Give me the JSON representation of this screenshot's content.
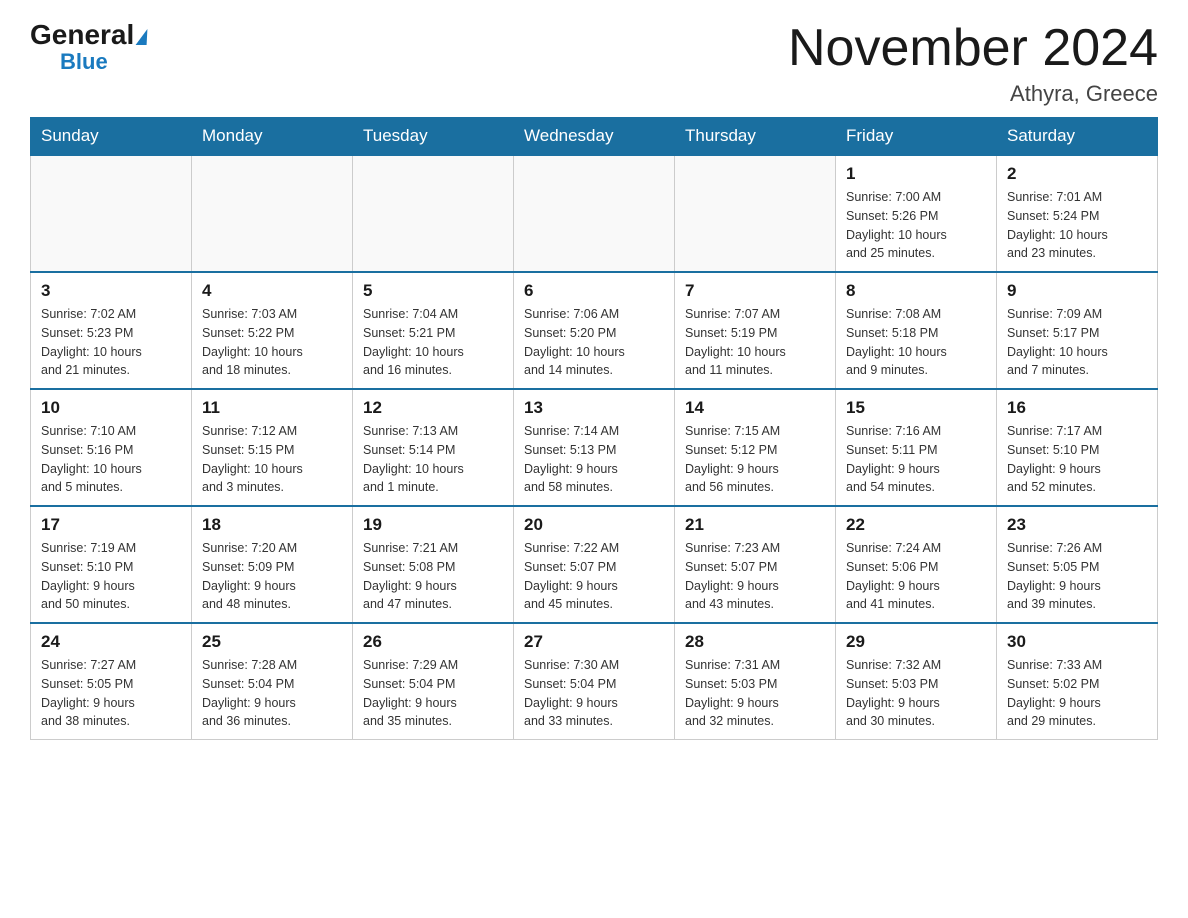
{
  "header": {
    "logo_general": "General",
    "logo_blue": "Blue",
    "title": "November 2024",
    "subtitle": "Athyra, Greece"
  },
  "days_of_week": [
    "Sunday",
    "Monday",
    "Tuesday",
    "Wednesday",
    "Thursday",
    "Friday",
    "Saturday"
  ],
  "weeks": [
    [
      {
        "day": "",
        "info": ""
      },
      {
        "day": "",
        "info": ""
      },
      {
        "day": "",
        "info": ""
      },
      {
        "day": "",
        "info": ""
      },
      {
        "day": "",
        "info": ""
      },
      {
        "day": "1",
        "info": "Sunrise: 7:00 AM\nSunset: 5:26 PM\nDaylight: 10 hours\nand 25 minutes."
      },
      {
        "day": "2",
        "info": "Sunrise: 7:01 AM\nSunset: 5:24 PM\nDaylight: 10 hours\nand 23 minutes."
      }
    ],
    [
      {
        "day": "3",
        "info": "Sunrise: 7:02 AM\nSunset: 5:23 PM\nDaylight: 10 hours\nand 21 minutes."
      },
      {
        "day": "4",
        "info": "Sunrise: 7:03 AM\nSunset: 5:22 PM\nDaylight: 10 hours\nand 18 minutes."
      },
      {
        "day": "5",
        "info": "Sunrise: 7:04 AM\nSunset: 5:21 PM\nDaylight: 10 hours\nand 16 minutes."
      },
      {
        "day": "6",
        "info": "Sunrise: 7:06 AM\nSunset: 5:20 PM\nDaylight: 10 hours\nand 14 minutes."
      },
      {
        "day": "7",
        "info": "Sunrise: 7:07 AM\nSunset: 5:19 PM\nDaylight: 10 hours\nand 11 minutes."
      },
      {
        "day": "8",
        "info": "Sunrise: 7:08 AM\nSunset: 5:18 PM\nDaylight: 10 hours\nand 9 minutes."
      },
      {
        "day": "9",
        "info": "Sunrise: 7:09 AM\nSunset: 5:17 PM\nDaylight: 10 hours\nand 7 minutes."
      }
    ],
    [
      {
        "day": "10",
        "info": "Sunrise: 7:10 AM\nSunset: 5:16 PM\nDaylight: 10 hours\nand 5 minutes."
      },
      {
        "day": "11",
        "info": "Sunrise: 7:12 AM\nSunset: 5:15 PM\nDaylight: 10 hours\nand 3 minutes."
      },
      {
        "day": "12",
        "info": "Sunrise: 7:13 AM\nSunset: 5:14 PM\nDaylight: 10 hours\nand 1 minute."
      },
      {
        "day": "13",
        "info": "Sunrise: 7:14 AM\nSunset: 5:13 PM\nDaylight: 9 hours\nand 58 minutes."
      },
      {
        "day": "14",
        "info": "Sunrise: 7:15 AM\nSunset: 5:12 PM\nDaylight: 9 hours\nand 56 minutes."
      },
      {
        "day": "15",
        "info": "Sunrise: 7:16 AM\nSunset: 5:11 PM\nDaylight: 9 hours\nand 54 minutes."
      },
      {
        "day": "16",
        "info": "Sunrise: 7:17 AM\nSunset: 5:10 PM\nDaylight: 9 hours\nand 52 minutes."
      }
    ],
    [
      {
        "day": "17",
        "info": "Sunrise: 7:19 AM\nSunset: 5:10 PM\nDaylight: 9 hours\nand 50 minutes."
      },
      {
        "day": "18",
        "info": "Sunrise: 7:20 AM\nSunset: 5:09 PM\nDaylight: 9 hours\nand 48 minutes."
      },
      {
        "day": "19",
        "info": "Sunrise: 7:21 AM\nSunset: 5:08 PM\nDaylight: 9 hours\nand 47 minutes."
      },
      {
        "day": "20",
        "info": "Sunrise: 7:22 AM\nSunset: 5:07 PM\nDaylight: 9 hours\nand 45 minutes."
      },
      {
        "day": "21",
        "info": "Sunrise: 7:23 AM\nSunset: 5:07 PM\nDaylight: 9 hours\nand 43 minutes."
      },
      {
        "day": "22",
        "info": "Sunrise: 7:24 AM\nSunset: 5:06 PM\nDaylight: 9 hours\nand 41 minutes."
      },
      {
        "day": "23",
        "info": "Sunrise: 7:26 AM\nSunset: 5:05 PM\nDaylight: 9 hours\nand 39 minutes."
      }
    ],
    [
      {
        "day": "24",
        "info": "Sunrise: 7:27 AM\nSunset: 5:05 PM\nDaylight: 9 hours\nand 38 minutes."
      },
      {
        "day": "25",
        "info": "Sunrise: 7:28 AM\nSunset: 5:04 PM\nDaylight: 9 hours\nand 36 minutes."
      },
      {
        "day": "26",
        "info": "Sunrise: 7:29 AM\nSunset: 5:04 PM\nDaylight: 9 hours\nand 35 minutes."
      },
      {
        "day": "27",
        "info": "Sunrise: 7:30 AM\nSunset: 5:04 PM\nDaylight: 9 hours\nand 33 minutes."
      },
      {
        "day": "28",
        "info": "Sunrise: 7:31 AM\nSunset: 5:03 PM\nDaylight: 9 hours\nand 32 minutes."
      },
      {
        "day": "29",
        "info": "Sunrise: 7:32 AM\nSunset: 5:03 PM\nDaylight: 9 hours\nand 30 minutes."
      },
      {
        "day": "30",
        "info": "Sunrise: 7:33 AM\nSunset: 5:02 PM\nDaylight: 9 hours\nand 29 minutes."
      }
    ]
  ]
}
